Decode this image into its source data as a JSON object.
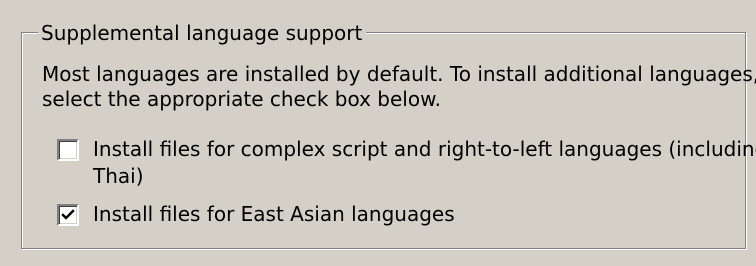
{
  "group": {
    "title": "Supplemental language support",
    "intro_lines": [
      "Most languages are installed by default. To install additional languages,",
      "select the appropriate check box below."
    ]
  },
  "options": [
    {
      "label_lines": [
        "Install files for complex script and right-to-left languages (including",
        "Thai)"
      ],
      "checked": false
    },
    {
      "label_lines": [
        "Install files for East Asian languages"
      ],
      "checked": true
    }
  ]
}
